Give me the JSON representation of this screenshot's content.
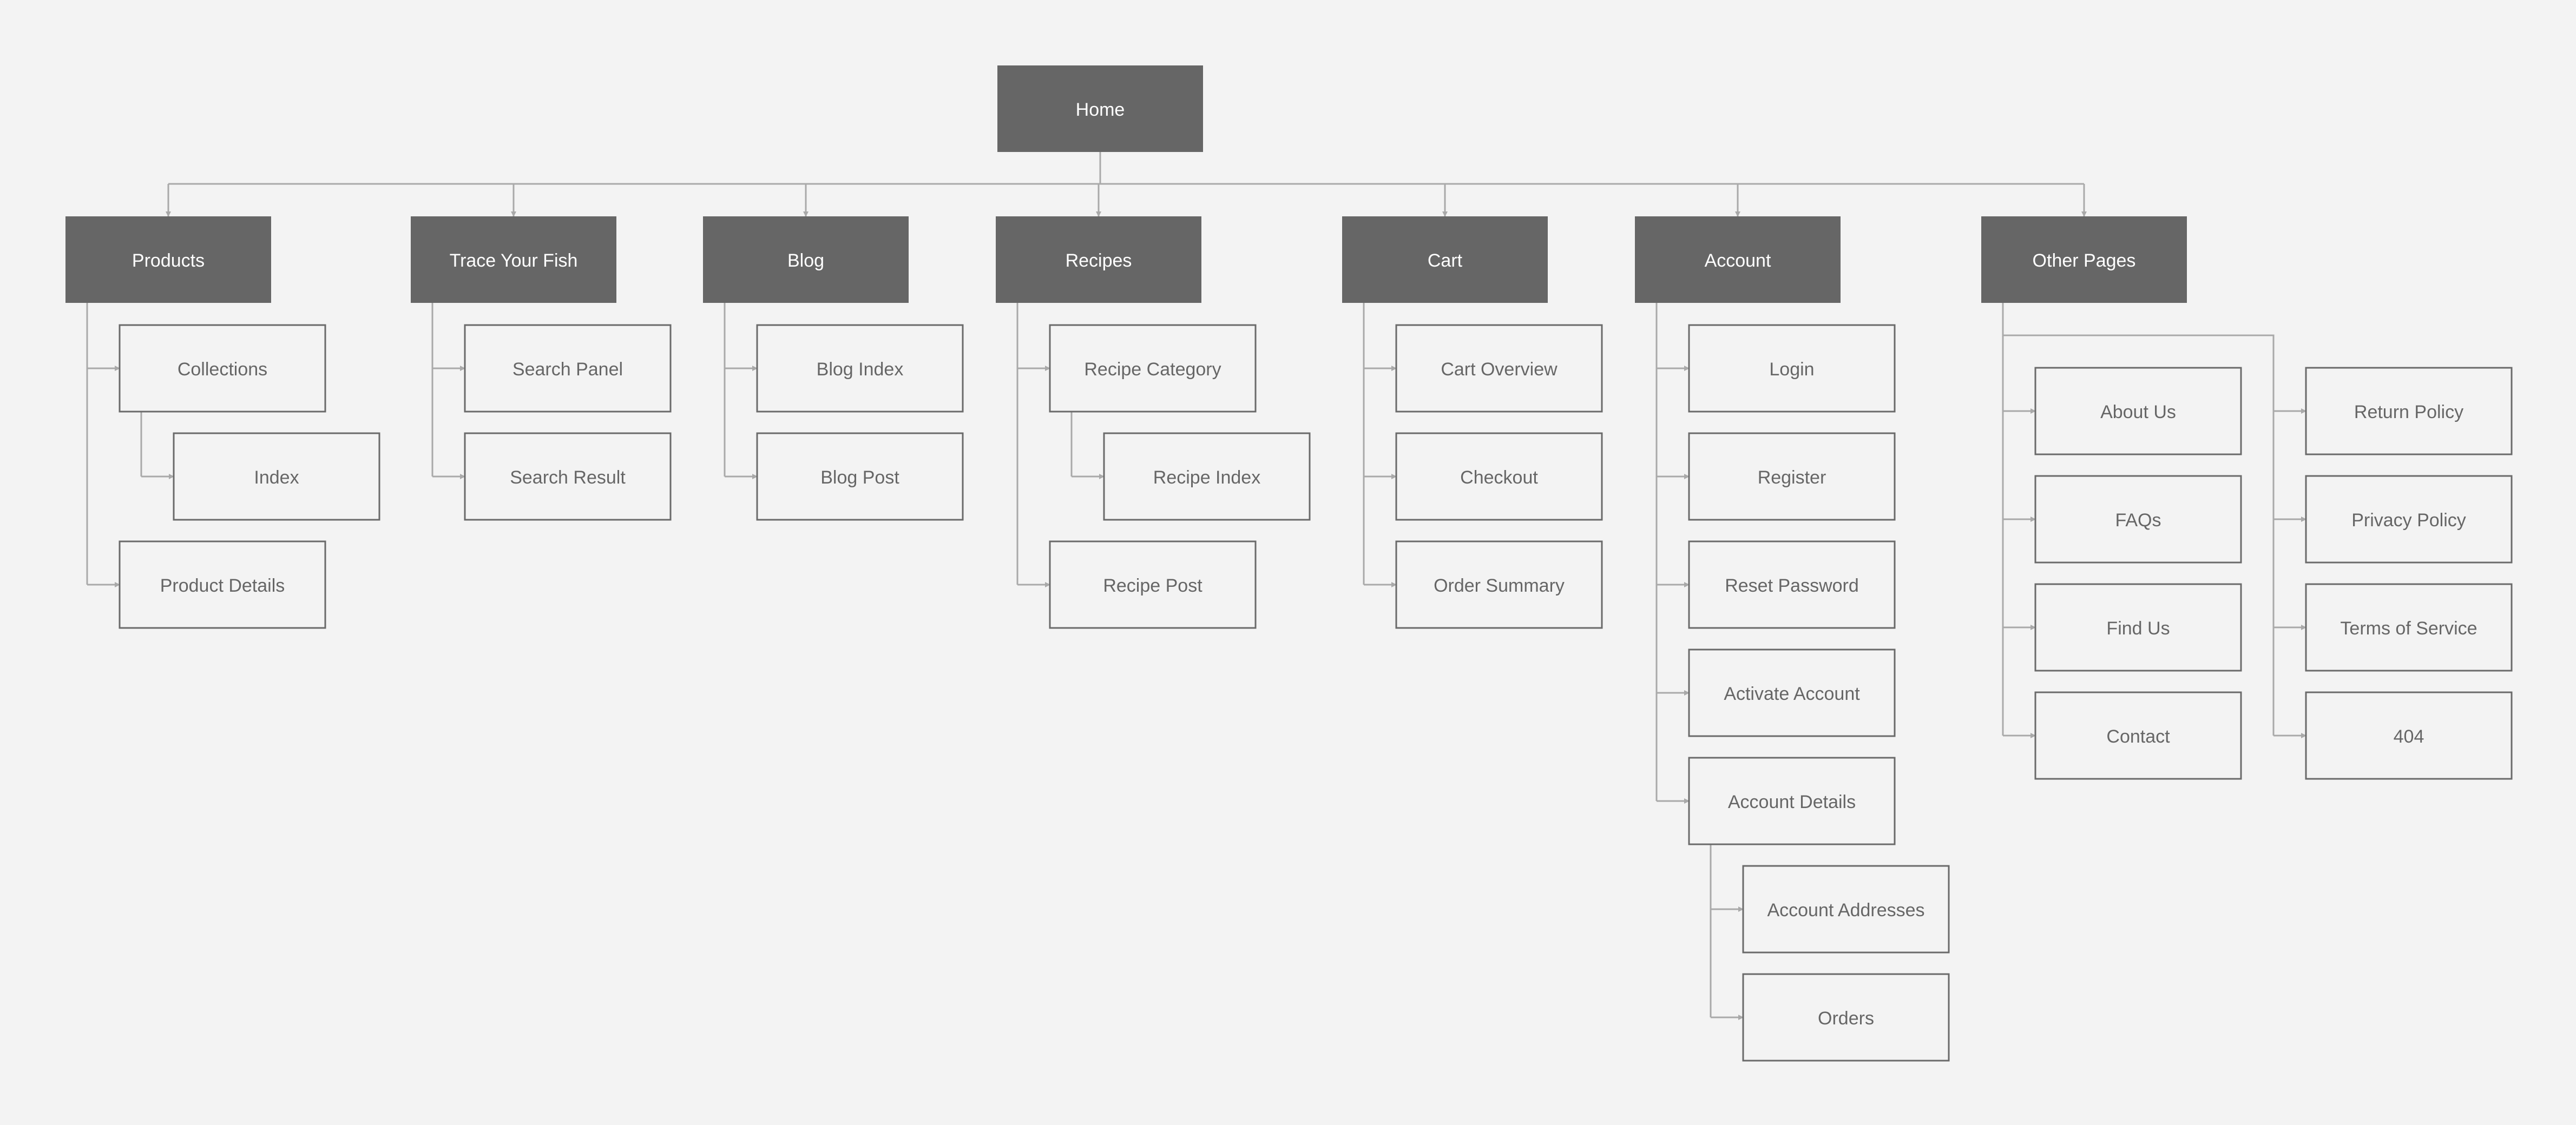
{
  "sitemap": {
    "root": {
      "label": "Home",
      "children": [
        {
          "label": "Products",
          "children": [
            {
              "label": "Collections",
              "children": [
                {
                  "label": "Index"
                }
              ]
            },
            {
              "label": "Product Details"
            }
          ]
        },
        {
          "label": "Trace Your Fish",
          "children": [
            {
              "label": "Search Panel"
            },
            {
              "label": "Search Result"
            }
          ]
        },
        {
          "label": "Blog",
          "children": [
            {
              "label": "Blog Index"
            },
            {
              "label": "Blog Post"
            }
          ]
        },
        {
          "label": "Recipes",
          "children": [
            {
              "label": "Recipe Category",
              "children": [
                {
                  "label": "Recipe Index"
                }
              ]
            },
            {
              "label": "Recipe Post"
            }
          ]
        },
        {
          "label": "Cart",
          "children": [
            {
              "label": "Cart Overview"
            },
            {
              "label": "Checkout"
            },
            {
              "label": "Order Summary"
            }
          ]
        },
        {
          "label": "Account",
          "children": [
            {
              "label": "Login"
            },
            {
              "label": "Register"
            },
            {
              "label": "Reset Password"
            },
            {
              "label": "Activate Account"
            },
            {
              "label": "Account Details",
              "children": [
                {
                  "label": "Account Addresses"
                },
                {
                  "label": "Orders"
                }
              ]
            }
          ]
        },
        {
          "label": "Other Pages",
          "children": [
            {
              "label": "About Us"
            },
            {
              "label": "FAQs"
            },
            {
              "label": "Find Us"
            },
            {
              "label": "Contact"
            },
            {
              "label": "Return Policy"
            },
            {
              "label": "Privacy Policy"
            },
            {
              "label": "Terms of Service"
            },
            {
              "label": "404"
            }
          ]
        }
      ]
    }
  },
  "colors": {
    "background": "#f3f3f3",
    "section_fill": "#666666",
    "section_text": "#ffffff",
    "page_border": "#6a6a6a",
    "page_text": "#666666",
    "connector": "#a9a9a9"
  }
}
